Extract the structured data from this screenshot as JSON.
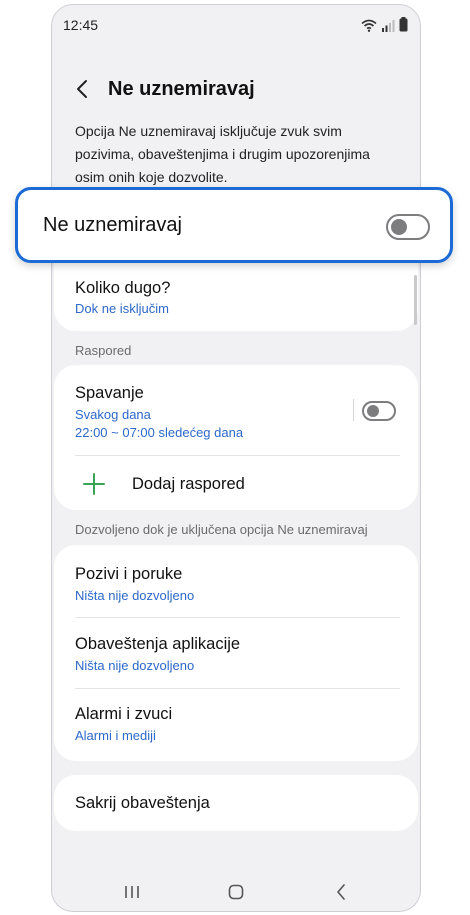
{
  "status_bar": {
    "time": "12:45",
    "icons": [
      "wifi-icon",
      "signal-icon",
      "battery-icon"
    ]
  },
  "header": {
    "back_icon": "chevron-left-icon",
    "title": "Ne uznemiravaj"
  },
  "description": "Opcija Ne uznemiravaj isključuje zvuk svim pozivima, obaveštenjima i drugim upozorenjima osim onih koje dozvolite.",
  "main_toggle": {
    "label": "Ne uznemiravaj",
    "on": false
  },
  "duration": {
    "title": "Koliko dugo?",
    "value": "Dok ne isključim"
  },
  "schedule": {
    "section_label": "Raspored",
    "items": [
      {
        "title": "Spavanje",
        "days": "Svakog dana",
        "time": "22:00 ~ 07:00 sledećeg dana",
        "on": false
      }
    ],
    "add_label": "Dodaj raspored"
  },
  "allowed": {
    "section_label": "Dozvoljeno dok je uključena opcija Ne uznemiravaj",
    "items": [
      {
        "title": "Pozivi i poruke",
        "value": "Ništa nije dozvoljeno"
      },
      {
        "title": "Obaveštenja aplikacije",
        "value": "Ništa nije dozvoljeno"
      },
      {
        "title": "Alarmi i zvuci",
        "value": "Alarmi i mediji"
      }
    ]
  },
  "hide": {
    "title": "Sakrij obaveštenja"
  },
  "colors": {
    "accent_link": "#2c68c9",
    "highlight_border": "#1b6ad6",
    "add_icon": "#3aa655",
    "background": "#f1f1f3"
  }
}
